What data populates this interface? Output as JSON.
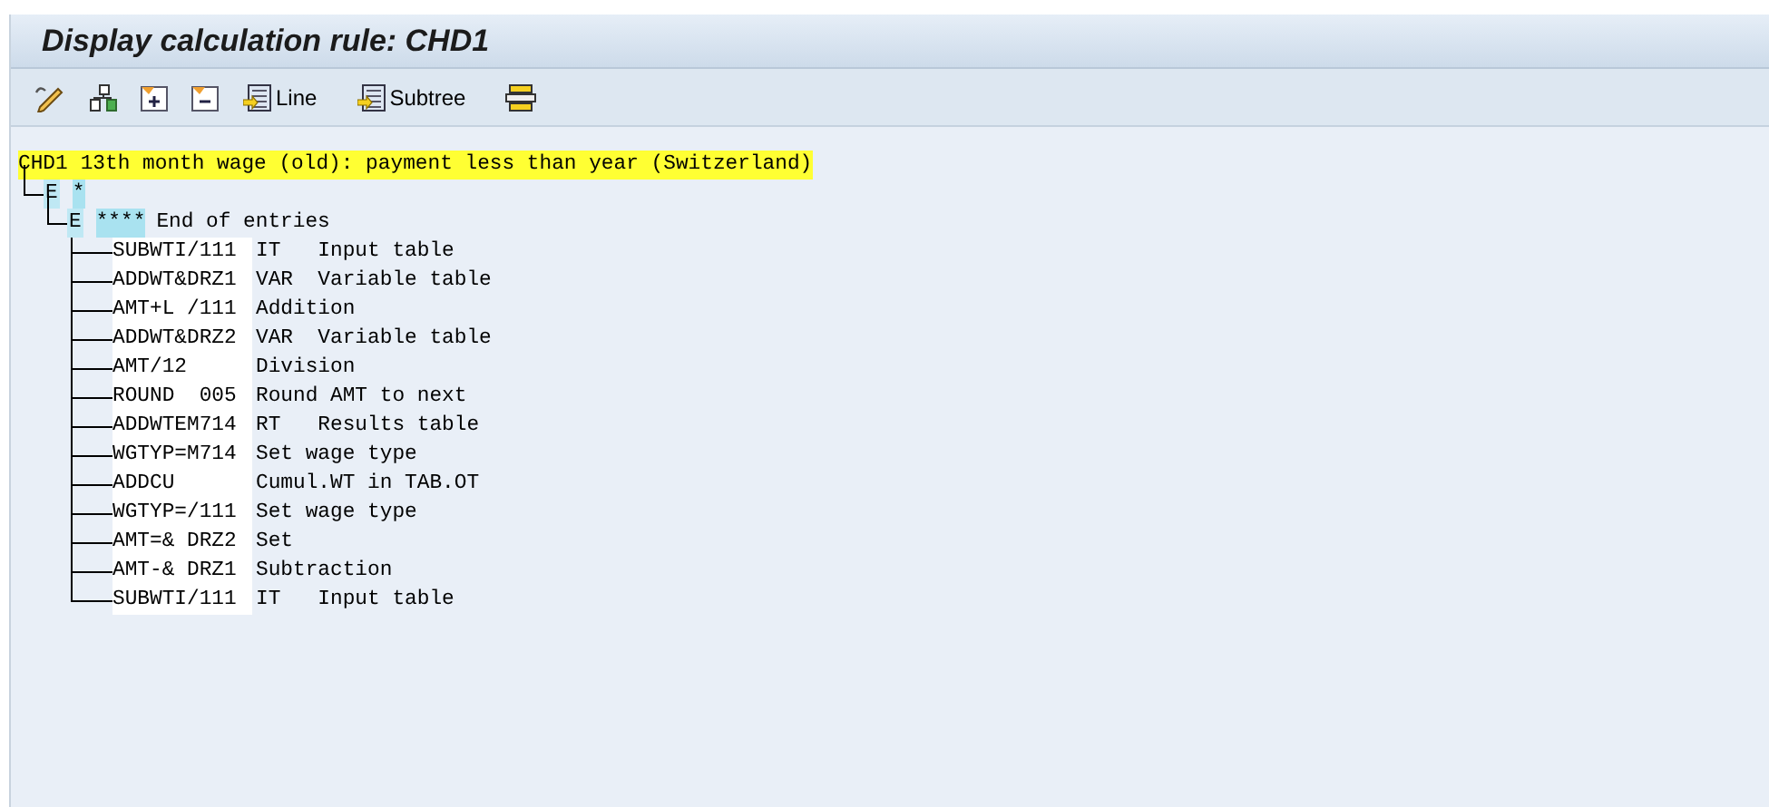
{
  "title": "Display calculation rule: CHD1",
  "toolbar": [
    {
      "kind": "pencil"
    },
    {
      "kind": "hierarchy"
    },
    {
      "kind": "expand"
    },
    {
      "kind": "collapse"
    },
    {
      "kind": "line",
      "label": "Line"
    },
    {
      "kind": "subtree",
      "label": "Subtree"
    },
    {
      "kind": "stack"
    }
  ],
  "tree": {
    "kind": "rule",
    "code": "CHD1",
    "text": "13th month wage (old): payment less than year (Switzerland)",
    "children": [
      {
        "kind": "group",
        "code": "E",
        "text": "*",
        "children": [
          {
            "kind": "group",
            "code": "E",
            "text": "****",
            "note": "End of entries",
            "children": [
              {
                "kind": "operation",
                "code": "SUBWTI/111",
                "text": "IT   Input table"
              },
              {
                "kind": "operation",
                "code": "ADDWT&DRZ1",
                "text": "VAR  Variable table"
              },
              {
                "kind": "operation",
                "code": "AMT+L /111",
                "text": "Addition"
              },
              {
                "kind": "operation",
                "code": "ADDWT&DRZ2",
                "text": "VAR  Variable table"
              },
              {
                "kind": "operation",
                "code": "AMT/12",
                "text": "Division"
              },
              {
                "kind": "operation",
                "code": "ROUND  005",
                "text": "Round AMT to next"
              },
              {
                "kind": "operation",
                "code": "ADDWTEM714",
                "text": "RT   Results table"
              },
              {
                "kind": "operation",
                "code": "WGTYP=M714",
                "text": "Set wage type"
              },
              {
                "kind": "operation",
                "code": "ADDCU",
                "text": "Cumul.WT in TAB.OT"
              },
              {
                "kind": "operation",
                "code": "WGTYP=/111",
                "text": "Set wage type"
              },
              {
                "kind": "operation",
                "code": "AMT=& DRZ2",
                "text": "Set"
              },
              {
                "kind": "operation",
                "code": "AMT-& DRZ1",
                "text": "Subtraction"
              },
              {
                "kind": "operation",
                "code": "SUBWTI/111",
                "text": "IT   Input table"
              }
            ]
          }
        ]
      }
    ]
  }
}
